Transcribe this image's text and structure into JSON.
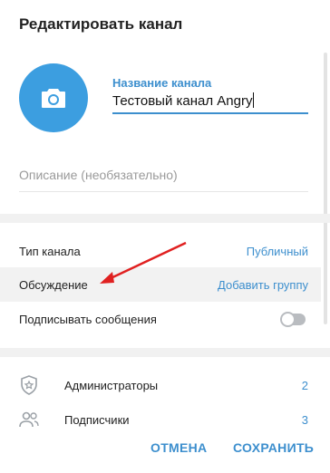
{
  "dialog": {
    "title": "Редактировать канал"
  },
  "channel": {
    "name_label": "Название канала",
    "name_value": "Тестовый канал Angry",
    "description_placeholder": "Описание (необязательно)"
  },
  "settings": {
    "type_label": "Тип канала",
    "type_value": "Публичный",
    "discussion_label": "Обсуждение",
    "discussion_value": "Добавить группу",
    "sign_label": "Подписывать сообщения",
    "sign_enabled": false
  },
  "members": {
    "admins_label": "Администраторы",
    "admins_count": "2",
    "subscribers_label": "Подписчики",
    "subscribers_count": "3"
  },
  "footer": {
    "cancel_label": "ОТМЕНА",
    "save_label": "СОХРАНИТЬ"
  },
  "colors": {
    "accent": "#3d8fce",
    "avatar": "#3c9ee0",
    "annotation_arrow": "#e02020"
  },
  "icons": {
    "avatar": "camera-icon",
    "admins": "shield-star-icon",
    "subscribers": "users-icon"
  }
}
